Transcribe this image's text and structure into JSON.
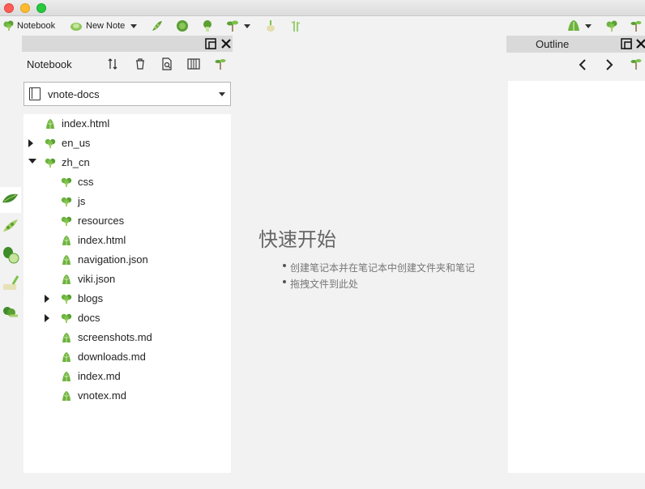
{
  "colors": {
    "accent_green": "#6db33f",
    "dark_green": "#3f8b2a",
    "pale_green": "#a6cf6b"
  },
  "toolbar": {
    "notebook_label": "Notebook",
    "new_note_label": "New Note",
    "icons": [
      "broccoli-icon",
      "lettuce-icon",
      "peas-icon",
      "cabbage-icon",
      "bok-choy-icon",
      "sprout-icon",
      "onion-icon",
      "herb-icon",
      "lettuce-icon",
      "broccoli-icon",
      "sprout-icon"
    ]
  },
  "notebook_panel": {
    "title": "Notebook",
    "selected_notebook": "vnote-docs",
    "tree": [
      {
        "label": "index.html",
        "type": "file",
        "level": 0
      },
      {
        "label": "en_us",
        "type": "folder",
        "level": 0,
        "expanded": false
      },
      {
        "label": "zh_cn",
        "type": "folder",
        "level": 0,
        "expanded": true
      },
      {
        "label": "css",
        "type": "folder",
        "level": 1
      },
      {
        "label": "js",
        "type": "folder",
        "level": 1
      },
      {
        "label": "resources",
        "type": "folder",
        "level": 1
      },
      {
        "label": "index.html",
        "type": "file",
        "level": 1
      },
      {
        "label": "navigation.json",
        "type": "file",
        "level": 1
      },
      {
        "label": "viki.json",
        "type": "file",
        "level": 1
      },
      {
        "label": "blogs",
        "type": "folder",
        "level": 1,
        "expanded": false
      },
      {
        "label": "docs",
        "type": "folder",
        "level": 1,
        "expanded": false
      },
      {
        "label": "screenshots.md",
        "type": "file",
        "level": 1
      },
      {
        "label": "downloads.md",
        "type": "file",
        "level": 1
      },
      {
        "label": "index.md",
        "type": "file",
        "level": 1
      },
      {
        "label": "vnotex.md",
        "type": "file",
        "level": 1
      }
    ]
  },
  "welcome": {
    "title": "快速开始",
    "items": [
      "创建笔记本并在笔记本中创建文件夹和笔记",
      "拖拽文件到此处"
    ]
  },
  "outline_panel": {
    "title": "Outline"
  }
}
